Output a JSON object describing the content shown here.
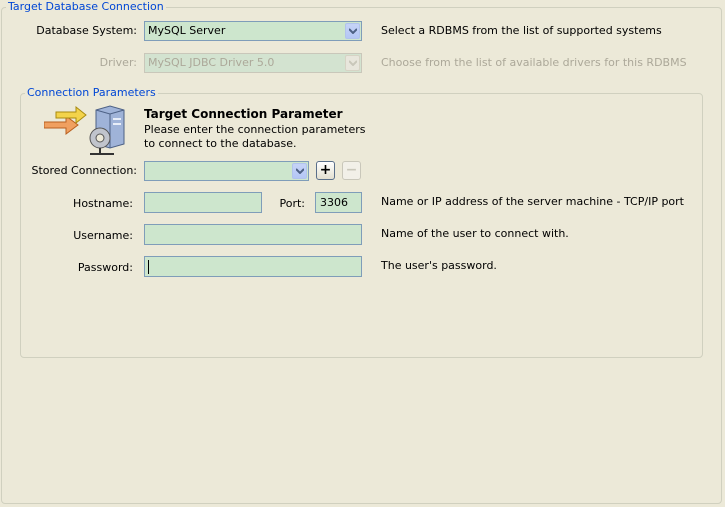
{
  "target_section": {
    "legend": "Target Database Connection",
    "database_system_label": "Database System:",
    "database_system_value": "MySQL Server",
    "database_system_hint": "Select a RDBMS from the list of supported systems",
    "driver_label": "Driver:",
    "driver_value": "MySQL JDBC Driver 5.0",
    "driver_hint": "Choose from the list of available drivers for this RDBMS"
  },
  "connection_section": {
    "legend": "Connection Parameters",
    "header_title": "Target Connection Parameter",
    "header_desc": "Please enter the connection parameters to connect to the database.",
    "icon": "network-server-icon",
    "stored_connection_label": "Stored Connection:",
    "stored_connection_value": "",
    "add_symbol": "+",
    "remove_symbol": "−",
    "hostname_label": "Hostname:",
    "hostname_value": "",
    "port_label": "Port:",
    "port_value": "3306",
    "hostname_hint": "Name or IP address of the server machine - TCP/IP port",
    "username_label": "Username:",
    "username_value": "",
    "username_hint": "Name of the user to connect with.",
    "password_label": "Password:",
    "password_value": "",
    "password_hint": "The user's password."
  },
  "colors": {
    "background": "#ece9d8",
    "legend_text": "#0046d5",
    "field_bg": "#cde6cd",
    "field_border": "#7f9db9",
    "disabled_text": "#aca899"
  }
}
